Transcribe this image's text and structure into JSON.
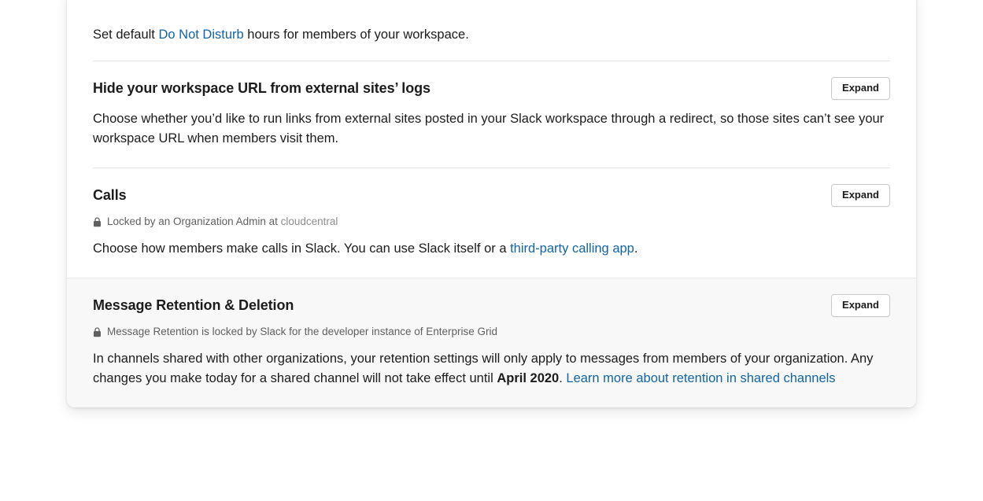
{
  "card": {
    "sections": [
      {
        "id": "do-not-disturb",
        "description_lead": "Set default ",
        "link_text": "Do Not Disturb",
        "description_tail": " hours for members of your workspace."
      },
      {
        "id": "hide-workspace-url",
        "title": "Hide your workspace URL from external sites’ logs",
        "expand_label": "Expand",
        "description": "Choose whether you’d like to run links from external sites posted in your Slack workspace through a redirect, so those sites can’t see your workspace URL when members visit them."
      },
      {
        "id": "calls",
        "title": "Calls",
        "expand_label": "Expand",
        "lock_icon": "lock-icon",
        "lock_text": "Locked by an Organization Admin at ",
        "lock_org": "cloudcentral",
        "description_lead": "Choose how members make calls in Slack. You can use Slack itself or a ",
        "link_text": "third-party calling app",
        "description_tail": "."
      },
      {
        "id": "message-retention-deletion",
        "title": "Message Retention & Deletion",
        "expand_label": "Expand",
        "lock_icon": "lock-icon",
        "lock_text": "Message Retention is locked by Slack for the developer instance of Enterprise Grid",
        "description_lead": "In channels shared with other organizations, your retention settings will only apply to messages from members of your organization. Any changes you make today for a shared channel will not take effect until ",
        "description_bold": "April 2020",
        "description_mid": ". ",
        "link_text": "Learn more about retention in shared channels"
      }
    ]
  },
  "colors": {
    "link": "#1264a3",
    "text": "#1d1c1d",
    "muted": "#616061",
    "muted_light": "#8d8d8d",
    "divider": "#e4e4e4",
    "shaded_bg": "#f8f8f8"
  }
}
